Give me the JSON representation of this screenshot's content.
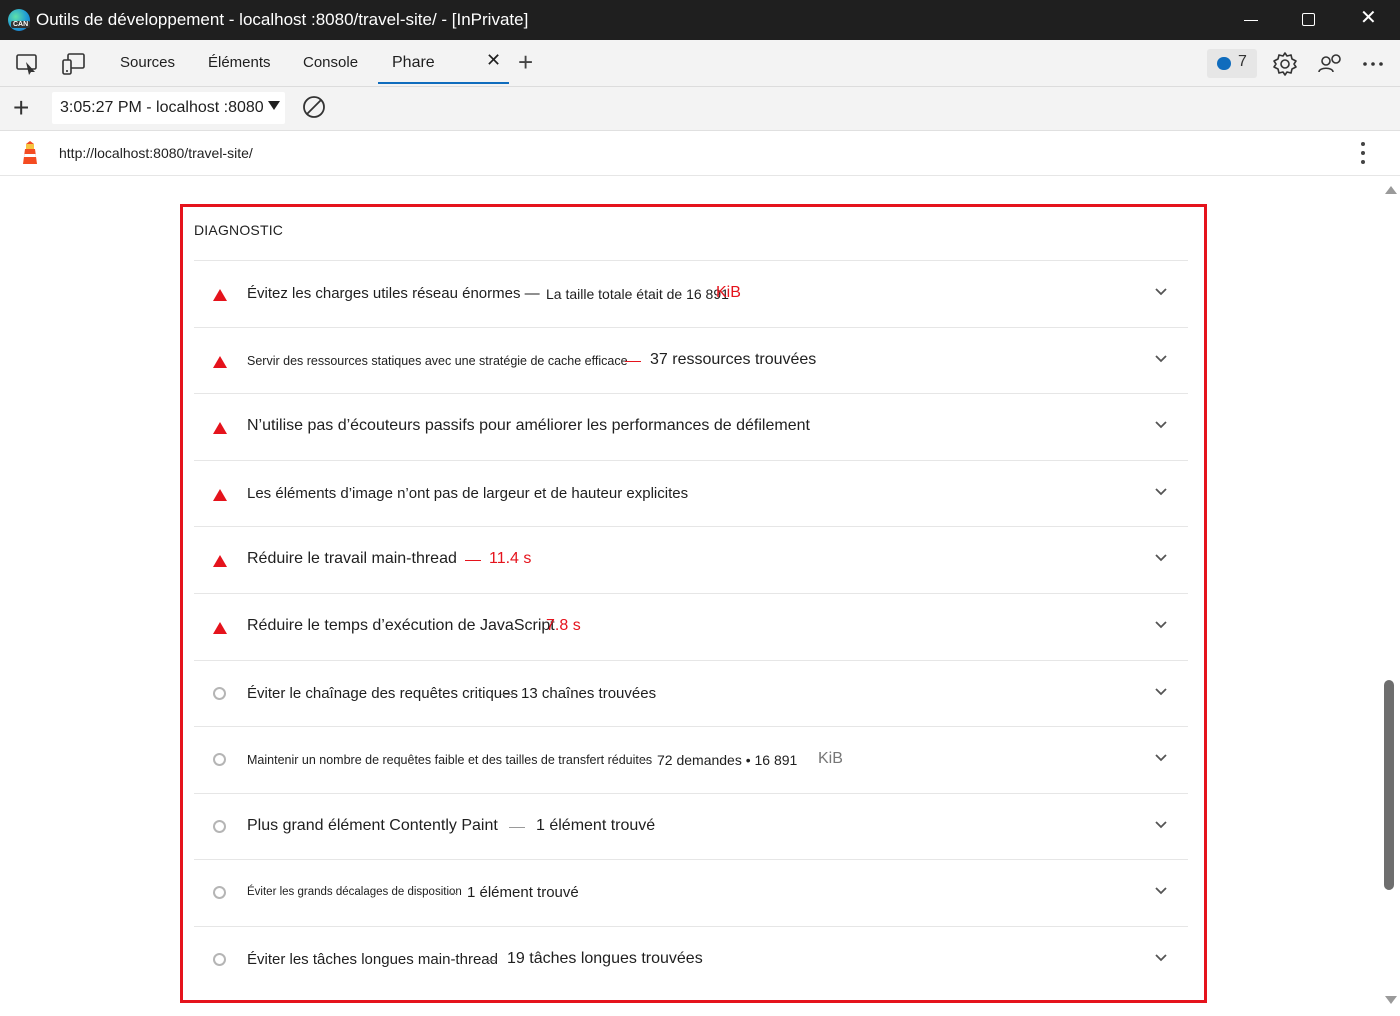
{
  "window": {
    "title": "Outils de développement - localhost :8080/travel-site/ - [InPrivate]",
    "icon": "edge-dev-icon"
  },
  "tabs": {
    "items": [
      {
        "label": "Sources"
      },
      {
        "label": "Éléments"
      },
      {
        "label": "Console"
      },
      {
        "label": "Phare",
        "active": true
      }
    ],
    "issues_count": "7"
  },
  "report": {
    "selected": "3:05:27 PM - localhost :8080"
  },
  "url": "http://localhost:8080/travel-site/",
  "section": {
    "title": "DIAGNOSTIC"
  },
  "audits": [
    {
      "status": "fail",
      "title": "Évitez les charges utiles réseau énormes —",
      "value": "La taille totale était de 16 891",
      "unit": "KiB"
    },
    {
      "status": "fail",
      "title": "Servir des ressources statiques avec une stratégie de cache efficace",
      "value": "37 ressources trouvées"
    },
    {
      "status": "fail",
      "title": "N’utilise pas d’écouteurs passifs pour améliorer les performances de défilement"
    },
    {
      "status": "fail",
      "title": "Les éléments d’image n’ont pas de largeur et de hauteur explicites"
    },
    {
      "status": "fail",
      "title": "Réduire le travail main-thread",
      "value": "11.4 s"
    },
    {
      "status": "fail",
      "title": "Réduire le temps d’exécution de JavaScript",
      "value": "7.8 s"
    },
    {
      "status": "info",
      "title": "Éviter le chaînage des requêtes critiques",
      "value": "13 chaînes trouvées"
    },
    {
      "status": "info",
      "title": "Maintenir un nombre de requêtes faible et des tailles de transfert réduites",
      "value": "72 demandes • 16 891",
      "unit": "KiB"
    },
    {
      "status": "info",
      "title": "Plus grand élément Contently Paint",
      "value": "1 élément trouvé"
    },
    {
      "status": "info",
      "title": "Éviter les grands décalages de disposition",
      "value": "1 élément trouvé"
    },
    {
      "status": "info",
      "title": "Éviter les tâches longues main-thread",
      "value": "19 tâches longues trouvées"
    }
  ],
  "colors": {
    "fail": "#e5131c",
    "highlight": "#e5131c",
    "accent": "#0f6cbd"
  }
}
